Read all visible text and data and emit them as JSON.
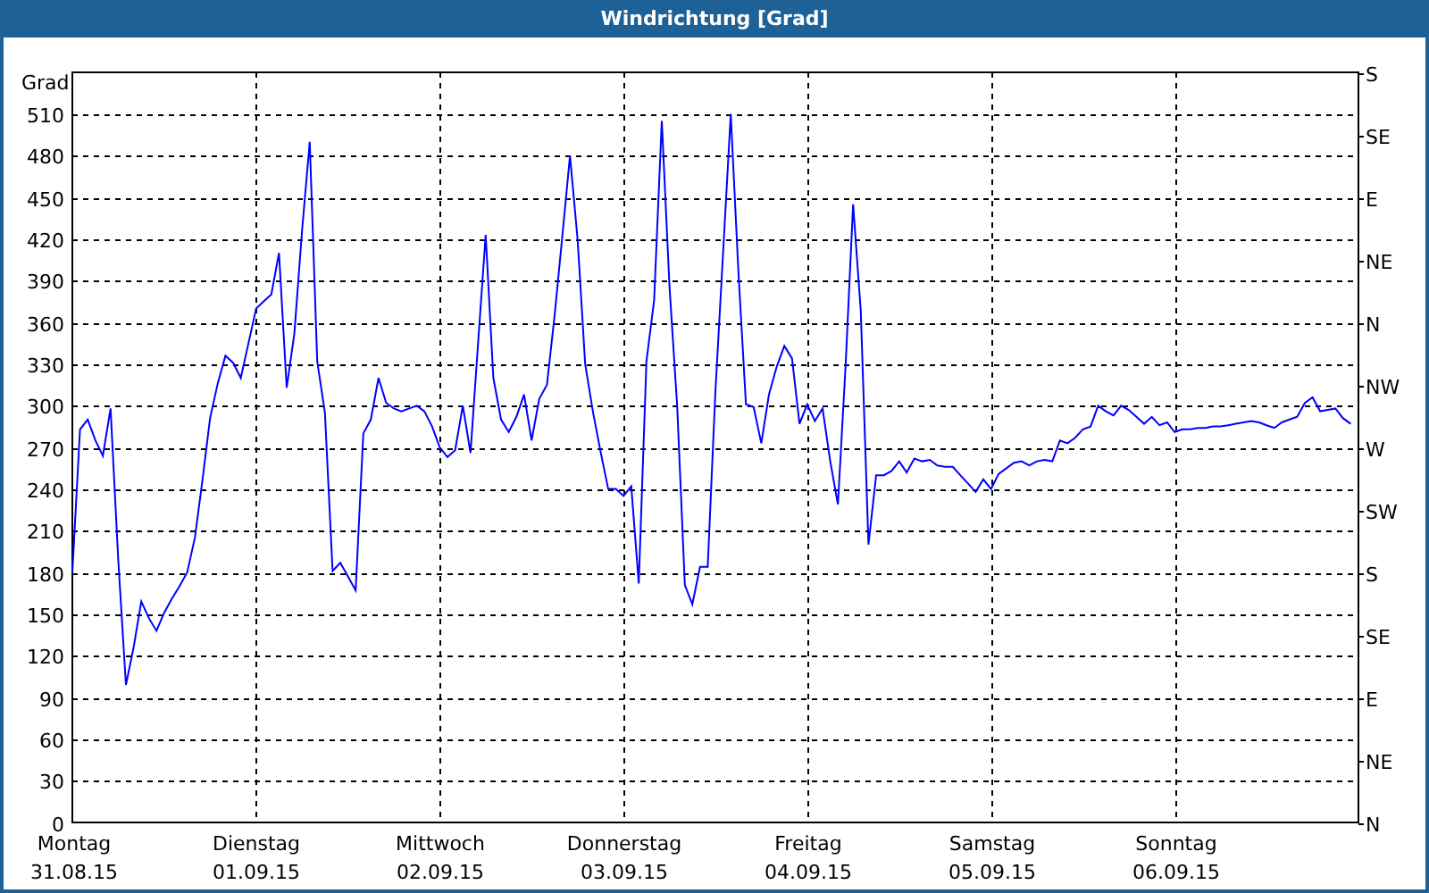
{
  "window": {
    "title": "Windrichtung [Grad]"
  },
  "chart": {
    "chart_data": {
      "type": "line",
      "ylabel": "Grad",
      "categories": [
        "Montag 31.08.15",
        null,
        null,
        null,
        null,
        null,
        null,
        null,
        null,
        null,
        null,
        null,
        null,
        null,
        null,
        null,
        null,
        null,
        null,
        null,
        null,
        null,
        null,
        null,
        "Dienstag 01.09.15",
        null,
        null,
        null,
        null,
        null,
        null,
        null,
        null,
        null,
        null,
        null,
        null,
        null,
        null,
        null,
        null,
        null,
        null,
        null,
        null,
        null,
        null,
        null,
        "Mittwoch 02.09.15",
        null,
        null,
        null,
        null,
        null,
        null,
        null,
        null,
        null,
        null,
        null,
        null,
        null,
        null,
        null,
        null,
        null,
        null,
        null,
        null,
        null,
        null,
        null,
        "Donnerstag 03.09.15",
        null,
        null,
        null,
        null,
        null,
        null,
        null,
        null,
        null,
        null,
        null,
        null,
        null,
        null,
        null,
        null,
        null,
        null,
        null,
        null,
        null,
        null,
        null,
        "Freitag 04.09.15",
        null,
        null,
        null,
        null,
        null,
        null,
        null,
        null,
        null,
        null,
        null,
        null,
        null,
        null,
        null,
        null,
        null,
        null,
        null,
        null,
        null,
        null,
        null,
        "Samstag 05.09.15",
        null,
        null,
        null,
        null,
        null,
        null,
        null,
        null,
        null,
        null,
        null,
        null,
        null,
        null,
        null,
        null,
        null,
        null,
        null,
        null,
        null,
        null,
        null,
        "Sonntag 06.09.15",
        null,
        null,
        null,
        null,
        null,
        null,
        null,
        null,
        null,
        null,
        null,
        null,
        null,
        null,
        null,
        null,
        null,
        null,
        null,
        null,
        null,
        null,
        null
      ],
      "values": [
        180,
        283,
        290,
        275,
        264,
        298,
        189,
        99,
        126,
        159,
        147,
        138,
        151,
        161,
        170,
        180,
        205,
        247,
        291,
        316,
        336,
        331,
        320,
        345,
        370,
        375,
        380,
        410,
        313,
        352,
        426,
        490,
        332,
        295,
        181,
        187,
        177,
        167,
        280,
        290,
        320,
        302,
        298,
        296,
        298,
        300,
        296,
        285,
        270,
        263,
        268,
        300,
        266,
        344,
        423,
        320,
        290,
        281,
        292,
        308,
        275,
        305,
        315,
        365,
        422,
        480,
        419,
        330,
        296,
        267,
        240,
        240,
        235,
        242,
        172,
        332,
        376,
        505,
        386,
        300,
        171,
        157,
        184,
        184,
        310,
        410,
        510,
        396,
        301,
        299,
        273,
        308,
        328,
        343,
        334,
        287,
        301,
        289,
        298,
        260,
        229,
        329,
        445,
        368,
        200,
        250,
        250,
        253,
        260,
        252,
        262,
        260,
        261,
        257,
        256,
        256,
        250,
        244,
        238,
        247,
        240,
        251,
        255,
        259,
        260,
        257,
        260,
        261,
        260,
        275,
        273,
        277,
        283,
        285,
        300,
        296,
        293,
        300,
        297,
        292,
        287,
        292,
        286,
        288,
        281,
        283,
        283,
        284,
        284,
        285,
        285,
        286,
        287,
        288,
        289,
        288,
        286,
        284,
        288,
        290,
        292,
        302,
        306,
        296,
        297,
        298,
        291,
        287
      ],
      "ylim": [
        0,
        540
      ],
      "grid": true,
      "yticks": [
        0,
        30,
        60,
        90,
        120,
        150,
        180,
        210,
        240,
        270,
        300,
        330,
        360,
        390,
        420,
        450,
        480,
        510
      ]
    },
    "compass_labels": [
      "S",
      "SE",
      "E",
      "NE",
      "N",
      "NW",
      "W",
      "SW",
      "S",
      "SE",
      "E",
      "NE",
      "N"
    ]
  }
}
